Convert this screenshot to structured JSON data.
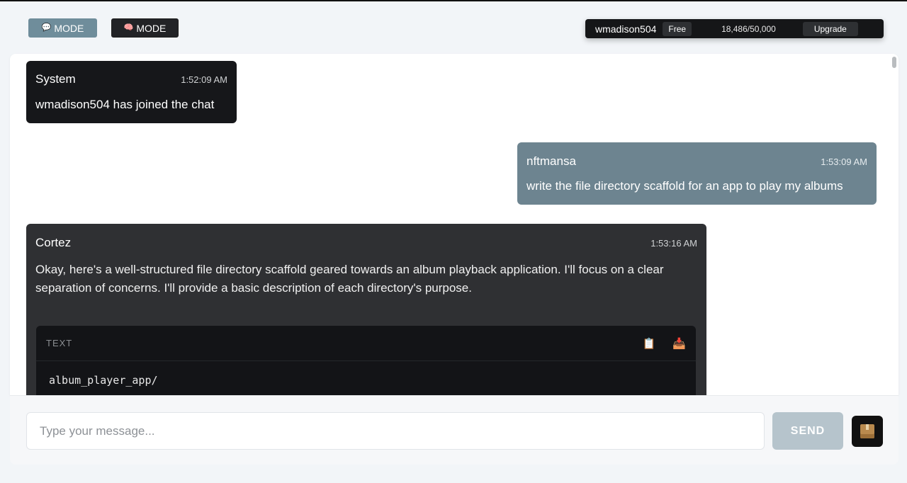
{
  "header": {
    "mode_buttons": [
      {
        "icon": "speech-bubble-icon",
        "label": "MODE"
      },
      {
        "icon": "brain-icon",
        "label": "MODE"
      }
    ],
    "account": {
      "username": "wmadison504",
      "plan": "Free",
      "usage": "18,486/50,000",
      "upgrade_label": "Upgrade"
    }
  },
  "messages": [
    {
      "sender": "System",
      "time": "1:52:09 AM",
      "text": "wmadison504 has joined the chat"
    },
    {
      "sender": "nftmansa",
      "time": "1:53:09 AM",
      "text": "write the file directory scaffold for an app to play my albums"
    },
    {
      "sender": "Cortez",
      "time": "1:53:16 AM",
      "text": "Okay, here's a well-structured file directory scaffold geared towards an album playback application. I'll focus on a clear separation of concerns.  I'll provide a basic description of each directory's purpose.",
      "code": {
        "language": "TEXT",
        "copy_icon": "clipboard-icon",
        "save_icon": "download-tray-icon",
        "first_line": "album_player_app/"
      }
    }
  ],
  "composer": {
    "placeholder": "Type your message...",
    "send_label": "SEND",
    "extra_icon": "package-icon"
  },
  "colors": {
    "chat_mode_active": "#6f8d9b",
    "user_bubble": "#6d8490",
    "bot_bubble": "#2f3033",
    "system_bubble": "#16171a",
    "send_disabled": "#b6c4cc"
  }
}
